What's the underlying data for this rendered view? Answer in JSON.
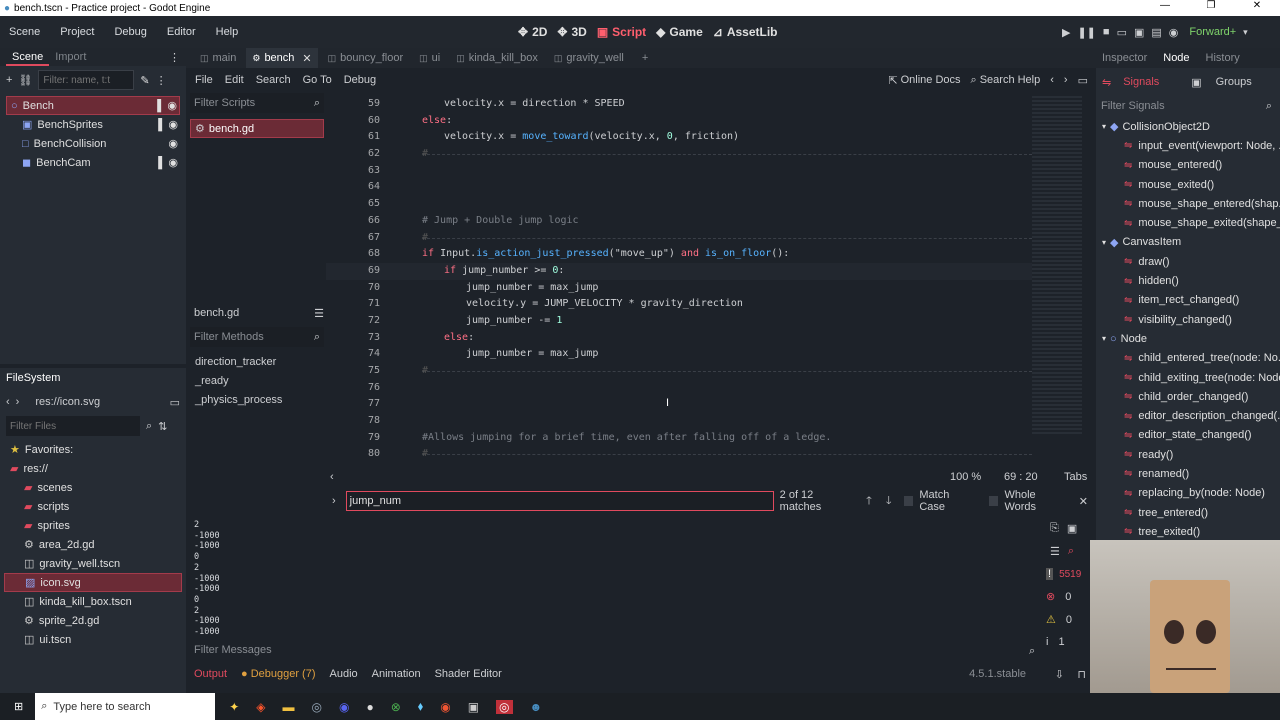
{
  "window": {
    "title": "bench.tscn - Practice project - Godot Engine"
  },
  "menus": [
    "Scene",
    "Project",
    "Debug",
    "Editor",
    "Help"
  ],
  "workspaces": [
    {
      "label": "2D",
      "icon": "2d-icon"
    },
    {
      "label": "3D",
      "icon": "3d-icon"
    },
    {
      "label": "Script",
      "icon": "script-icon",
      "active": true
    },
    {
      "label": "Game",
      "icon": "game-icon"
    },
    {
      "label": "AssetLib",
      "icon": "assetlib-icon"
    }
  ],
  "renderer": "Forward+",
  "left_dock": {
    "tabs": [
      "Scene",
      "Import"
    ],
    "filter_placeholder": "Filter: name, t:t",
    "tree": [
      {
        "label": "Bench",
        "icon": "node2d-icon",
        "selected": true
      },
      {
        "label": "BenchSprites",
        "icon": "sprite-icon"
      },
      {
        "label": "BenchCollision",
        "icon": "collision-icon"
      },
      {
        "label": "BenchCam",
        "icon": "camera-icon"
      }
    ]
  },
  "filesystem": {
    "title": "FileSystem",
    "path": "res://icon.svg",
    "filter_placeholder": "Filter Files",
    "items": [
      {
        "label": "Favorites:",
        "indent": 0,
        "icon": "star-icon"
      },
      {
        "label": "res://",
        "indent": 0,
        "icon": "folder-icon"
      },
      {
        "label": "scenes",
        "indent": 1,
        "icon": "folder-icon"
      },
      {
        "label": "scripts",
        "indent": 1,
        "icon": "folder-icon"
      },
      {
        "label": "sprites",
        "indent": 1,
        "icon": "folder-icon"
      },
      {
        "label": "area_2d.gd",
        "indent": 1,
        "icon": "gear-icon"
      },
      {
        "label": "gravity_well.tscn",
        "indent": 1,
        "icon": "scene-icon"
      },
      {
        "label": "icon.svg",
        "indent": 1,
        "icon": "image-icon",
        "selected": true
      },
      {
        "label": "kinda_kill_box.tscn",
        "indent": 1,
        "icon": "scene-icon"
      },
      {
        "label": "sprite_2d.gd",
        "indent": 1,
        "icon": "gear-icon"
      },
      {
        "label": "ui.tscn",
        "indent": 1,
        "icon": "scene-icon"
      }
    ]
  },
  "scene_tabs": [
    {
      "label": "main"
    },
    {
      "label": "bench",
      "active": true
    },
    {
      "label": "bouncy_floor"
    },
    {
      "label": "ui"
    },
    {
      "label": "kinda_kill_box"
    },
    {
      "label": "gravity_well"
    }
  ],
  "script_menu": [
    "File",
    "Edit",
    "Search",
    "Go To",
    "Debug"
  ],
  "online_docs": "Online Docs",
  "search_help": "Search Help",
  "scripts_panel": {
    "filter_placeholder": "Filter Scripts",
    "scripts": [
      "bench.gd"
    ],
    "methods_title": "bench.gd",
    "methods_filter_placeholder": "Filter Methods",
    "methods": [
      "direction_tracker",
      "_ready",
      "_physics_process"
    ]
  },
  "code": [
    {
      "n": "59",
      "indent": 1,
      "text": "velocity.x = direction * SPEED"
    },
    {
      "n": "60",
      "indent": 0,
      "text": "else:"
    },
    {
      "n": "61",
      "indent": 1,
      "text": "velocity.x = move_toward(velocity.x, 0, friction)"
    },
    {
      "n": "62",
      "indent": 0,
      "text": "#",
      "rule": true
    },
    {
      "n": "63",
      "indent": 0,
      "text": ""
    },
    {
      "n": "64",
      "indent": 0,
      "text": ""
    },
    {
      "n": "65",
      "indent": 0,
      "text": ""
    },
    {
      "n": "66",
      "indent": 0,
      "text": "# Jump + Double jump logic",
      "comment": true
    },
    {
      "n": "67",
      "indent": 0,
      "text": "#",
      "rule": true
    },
    {
      "n": "68",
      "indent": 0,
      "text": "if Input.is_action_just_pressed(\"move_up\") and is_on_floor():"
    },
    {
      "n": "69",
      "indent": 1,
      "text": "if jump_number >= 0:",
      "current": true
    },
    {
      "n": "70",
      "indent": 2,
      "text": "jump_number = max_jump"
    },
    {
      "n": "71",
      "indent": 2,
      "text": "velocity.y = JUMP_VELOCITY * gravity_direction"
    },
    {
      "n": "72",
      "indent": 2,
      "text": "jump_number -= 1"
    },
    {
      "n": "73",
      "indent": 1,
      "text": "else:"
    },
    {
      "n": "74",
      "indent": 2,
      "text": "jump_number = max_jump"
    },
    {
      "n": "75",
      "indent": 0,
      "text": "#",
      "rule": true
    },
    {
      "n": "76",
      "indent": 0,
      "text": ""
    },
    {
      "n": "77",
      "indent": 0,
      "text": ""
    },
    {
      "n": "78",
      "indent": 0,
      "text": ""
    },
    {
      "n": "79",
      "indent": 0,
      "text": "#Allows jumping for a brief time, even after falling off of a ledge.",
      "comment": true
    },
    {
      "n": "80",
      "indent": 0,
      "text": "#",
      "rule": true
    }
  ],
  "status": {
    "zoom": "100 %",
    "cursor": "69 :  20",
    "indent_mode": "Tabs"
  },
  "find": {
    "query": "jump_num",
    "matches": "2 of 12 matches",
    "match_case": "Match Case",
    "whole_words": "Whole Words"
  },
  "output": {
    "lines": [
      "2",
      "-1000",
      "-1000",
      "0",
      "2",
      "-1000",
      "-1000",
      "0",
      "2",
      "-1000",
      "-1000"
    ],
    "filter_placeholder": "Filter Messages",
    "counts": {
      "messages": "5519",
      "errors": "0",
      "warnings": "0",
      "info": "1"
    }
  },
  "bottom_tabs": [
    "Output",
    "Debugger (7)",
    "Audio",
    "Animation",
    "Shader Editor"
  ],
  "version": "4.5.1.stable",
  "right_dock": {
    "tabs": [
      "Inspector",
      "Node",
      "History"
    ],
    "subtabs": [
      "Signals",
      "Groups"
    ],
    "filter_placeholder": "Filter Signals",
    "groups": [
      {
        "class": "CollisionObject2D",
        "signals": [
          "input_event(viewport: Node, ...",
          "mouse_entered()",
          "mouse_exited()",
          "mouse_shape_entered(shap...",
          "mouse_shape_exited(shape_..."
        ]
      },
      {
        "class": "CanvasItem",
        "signals": [
          "draw()",
          "hidden()",
          "item_rect_changed()",
          "visibility_changed()"
        ]
      },
      {
        "class": "Node",
        "signals": [
          "child_entered_tree(node: No...",
          "child_exiting_tree(node: Node)",
          "child_order_changed()",
          "editor_description_changed(...",
          "editor_state_changed()",
          "ready()",
          "renamed()",
          "replacing_by(node: Node)",
          "tree_entered()",
          "tree_exited()"
        ]
      }
    ]
  },
  "taskbar": {
    "search_placeholder": "Type here to search"
  },
  "colors": {
    "accent": "#e04a5e",
    "bg": "#1d2229",
    "panel": "#262c34"
  }
}
